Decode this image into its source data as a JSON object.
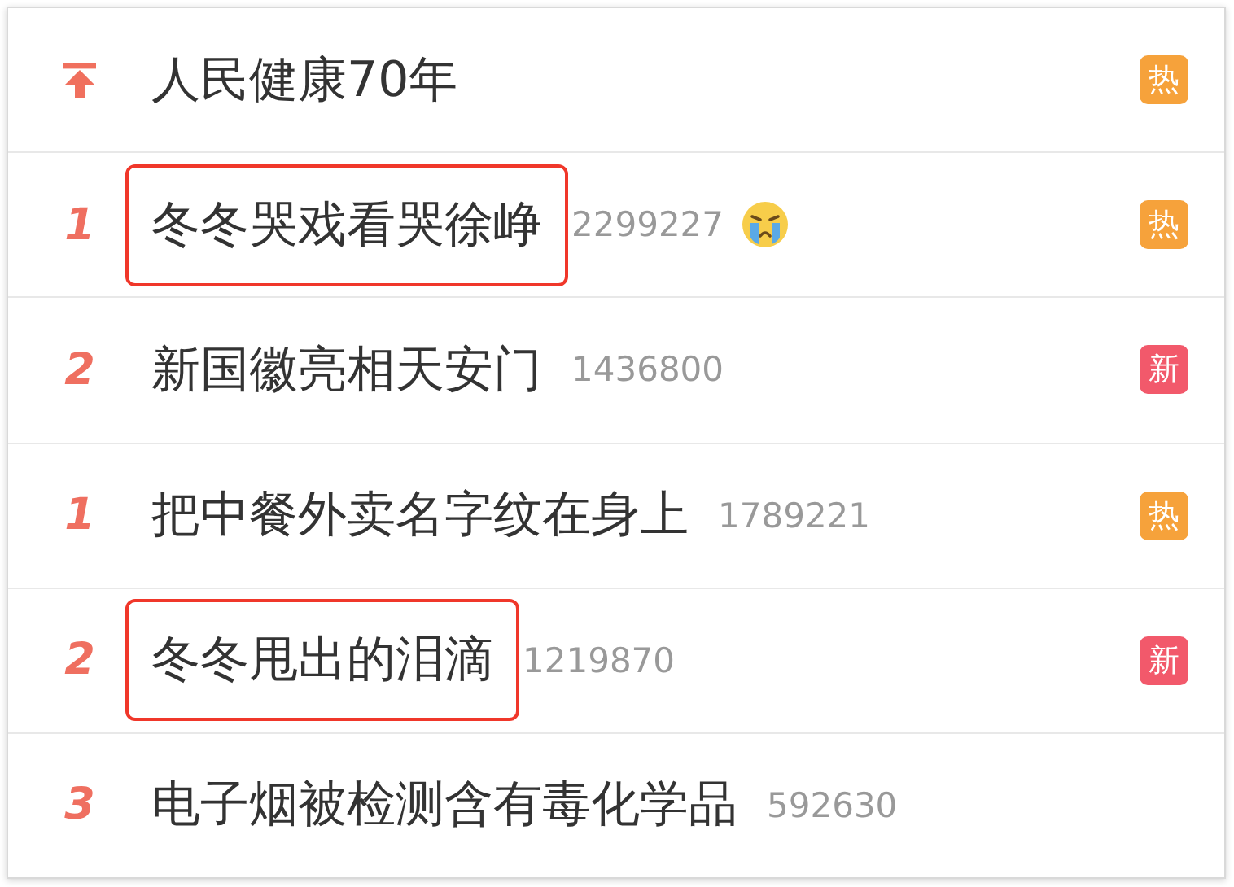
{
  "rows": [
    {
      "kind": "pinned",
      "title": "人民健康70年",
      "highlighted": false,
      "badge": {
        "label": "热",
        "color": "#f6a23b"
      }
    },
    {
      "kind": "ranked",
      "rank": "1",
      "title": "冬冬哭戏看哭徐峥",
      "count": "2299227",
      "highlighted": true,
      "emoji_icon": true,
      "badge": {
        "label": "热",
        "color": "#f6a23b"
      }
    },
    {
      "kind": "ranked",
      "rank": "2",
      "title": "新国徽亮相天安门",
      "count": "1436800",
      "highlighted": false,
      "badge": {
        "label": "新",
        "color": "#f2596b"
      }
    },
    {
      "kind": "ranked",
      "rank": "1",
      "title": "把中餐外卖名字纹在身上",
      "count": "1789221",
      "highlighted": false,
      "badge": {
        "label": "热",
        "color": "#f6a23b"
      }
    },
    {
      "kind": "ranked",
      "rank": "2",
      "title": "冬冬甩出的泪滴",
      "count": "1219870",
      "highlighted": true,
      "badge": {
        "label": "新",
        "color": "#f2596b"
      }
    },
    {
      "kind": "ranked",
      "rank": "3",
      "title": "电子烟被检测含有毒化学品",
      "count": "592630",
      "highlighted": false
    }
  ]
}
